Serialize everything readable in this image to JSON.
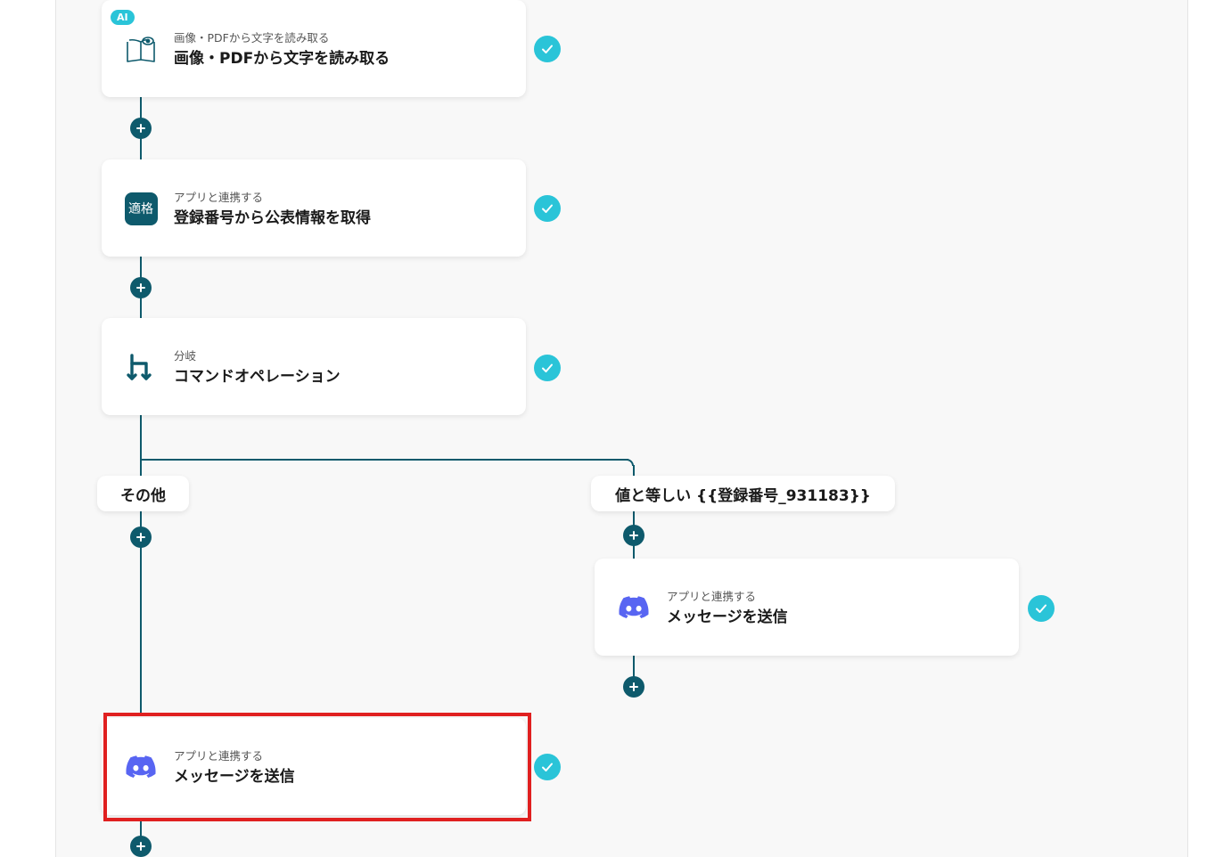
{
  "steps": [
    {
      "badge": "AI",
      "sub": "画像・PDFから文字を読み取る",
      "title": "画像・PDFから文字を読み取る",
      "icon": "book-eye-icon"
    },
    {
      "sub": "アプリと連携する",
      "title": "登録番号から公表情報を取得",
      "icon_text": "適格",
      "icon": "tekikaku-app-icon"
    },
    {
      "sub": "分岐",
      "title": "コマンドオペレーション",
      "icon": "branch-icon"
    }
  ],
  "branches": {
    "left": {
      "label": "その他",
      "step": {
        "sub": "アプリと連携する",
        "title": "メッセージを送信",
        "icon": "discord-icon"
      }
    },
    "right": {
      "label": "値と等しい {{登録番号_931183}}",
      "step": {
        "sub": "アプリと連携する",
        "title": "メッセージを送信",
        "icon": "discord-icon"
      }
    }
  },
  "colors": {
    "line": "#0e5a6c",
    "check": "#2ac4d8",
    "discord": "#5865f2",
    "highlight": "#e02020"
  }
}
